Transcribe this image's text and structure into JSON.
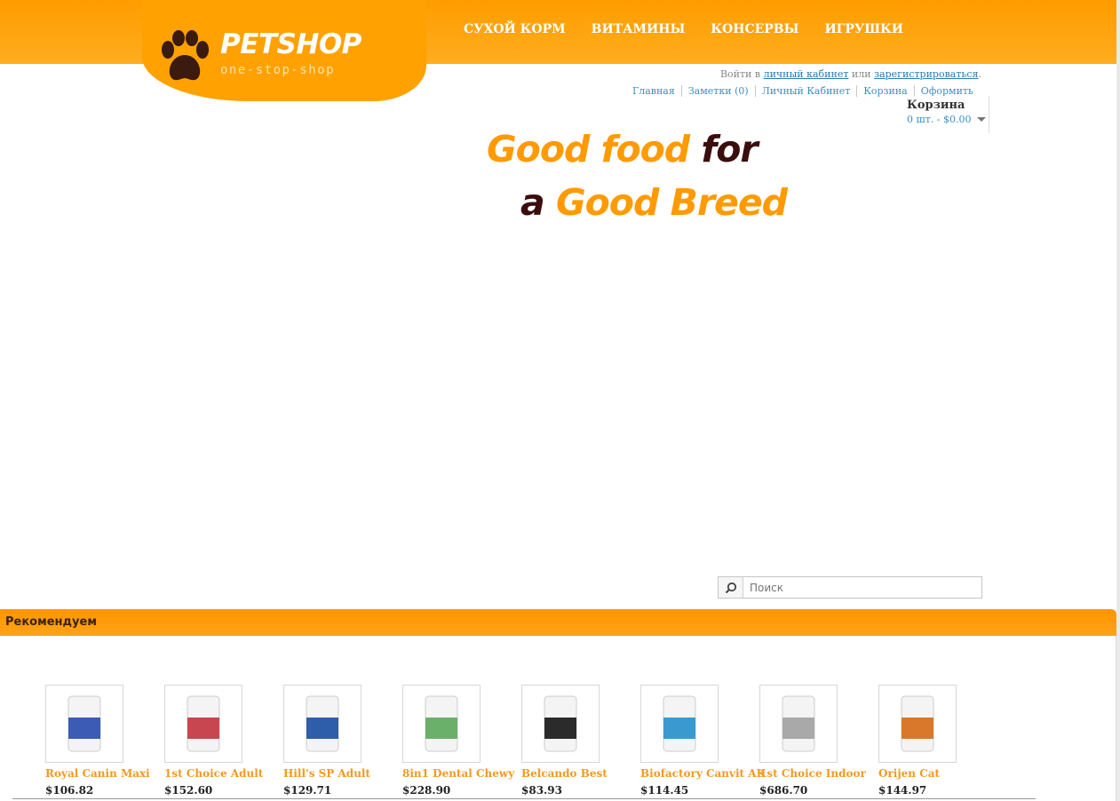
{
  "brand": {
    "name": "PETSHOP",
    "tagline": "one-stop-shop"
  },
  "nav": [
    {
      "label": "СУХОЙ КОРМ"
    },
    {
      "label": "ВИТАМИНЫ"
    },
    {
      "label": "КОНСЕРВЫ"
    },
    {
      "label": "ИГРУШКИ"
    }
  ],
  "account": {
    "prefix": "Войти в",
    "login_link": "личный кабинет",
    "middle": "или",
    "register_link": "зарегистрироваться",
    "suffix": "."
  },
  "quick_links": [
    {
      "label": "Главная"
    },
    {
      "label": "Заметки (0)"
    },
    {
      "label": "Личный Кабинет"
    },
    {
      "label": "Корзина"
    },
    {
      "label": "Оформить"
    }
  ],
  "cart": {
    "title": "Корзина",
    "summary": "0 шт. - $0.00"
  },
  "banner": {
    "line1_orange": "Good food",
    "line1_dark": "for",
    "line2_dark": "a",
    "line2_orange": "Good Breed"
  },
  "search": {
    "placeholder": "Поиск"
  },
  "recommended": {
    "title": "Рекомендуем",
    "products": [
      {
        "name": "Royal Canin Maxi",
        "price": "$106.82",
        "color": "#3b5bb5"
      },
      {
        "name": "1st Choice Adult",
        "price": "$152.60",
        "color": "#c8464f"
      },
      {
        "name": "Hill's SP Adult",
        "price": "$129.71",
        "color": "#2e5ea8"
      },
      {
        "name": "8in1 Dental Chewy",
        "price": "$228.90",
        "color": "#6ab06a"
      },
      {
        "name": "Belcando Best",
        "price": "$83.93",
        "color": "#2b2b2b"
      },
      {
        "name": "Biofactory Canvit AK",
        "price": "$114.45",
        "color": "#3a9ad0"
      },
      {
        "name": "1st Choice Indoor",
        "price": "$686.70",
        "color": "#a9a9a9"
      },
      {
        "name": "Orijen Cat",
        "price": "$144.97",
        "color": "#d9782b"
      }
    ]
  },
  "colors": {
    "accent": "#ff9c00",
    "link": "#3b8fc4",
    "price_name": "#f39a20"
  }
}
